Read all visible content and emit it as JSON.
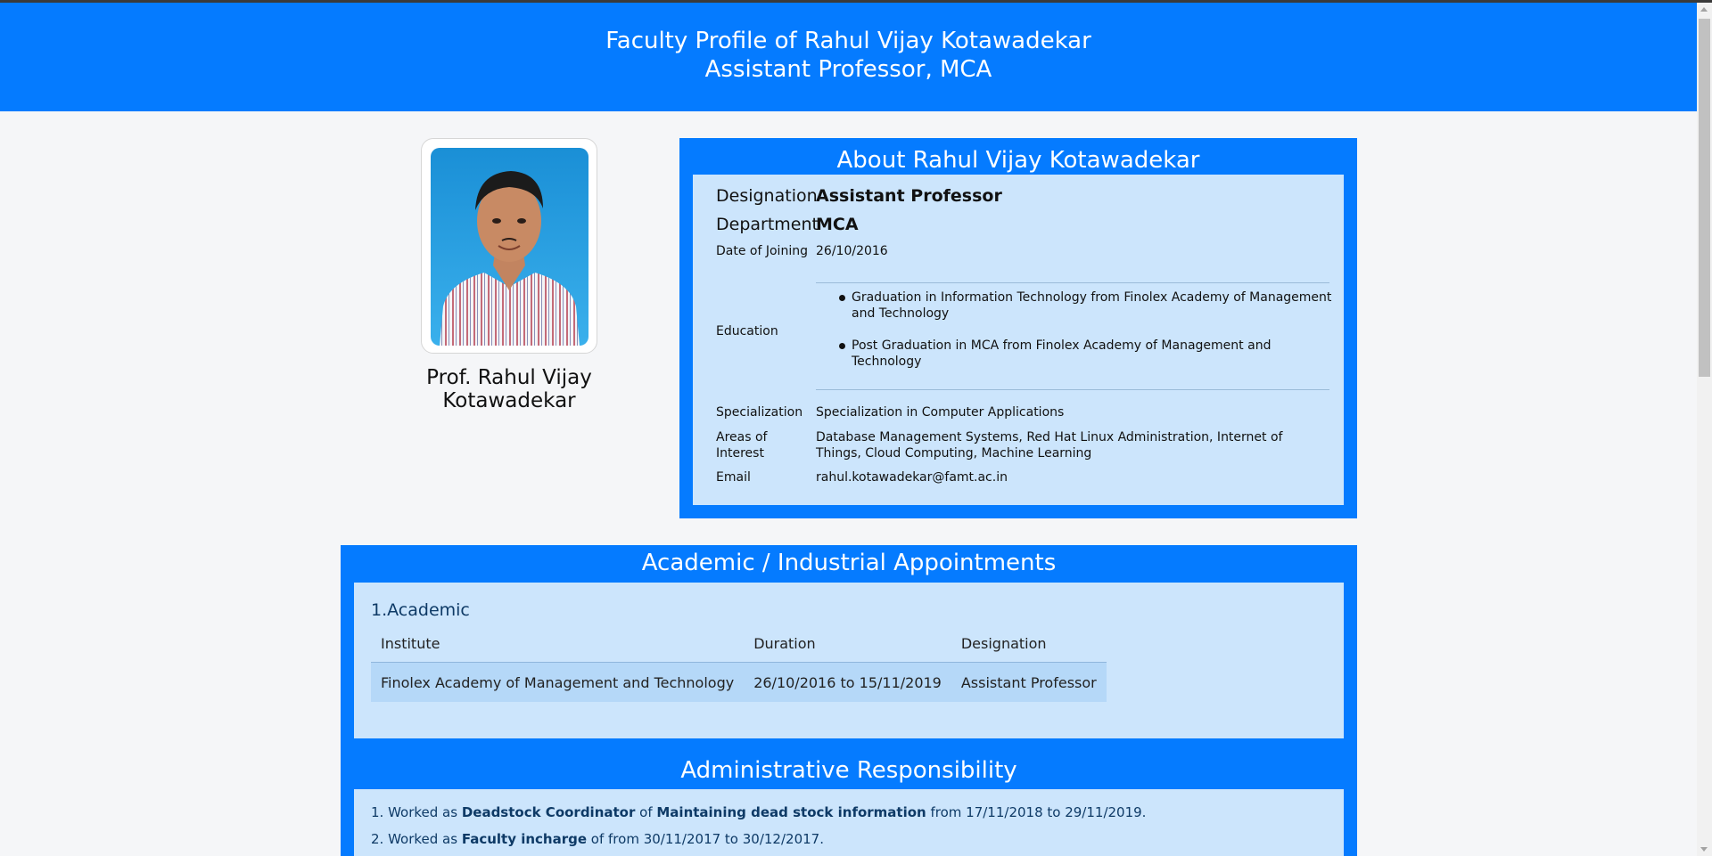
{
  "header": {
    "title_line1": "Faculty Profile of Rahul Vijay Kotawadekar",
    "title_line2": "Assistant Professor, MCA"
  },
  "profile": {
    "name": "Prof. Rahul Vijay Kotawadekar"
  },
  "about": {
    "heading": "About Rahul Vijay Kotawadekar",
    "designation_label": "Designation",
    "designation_value": "Assistant Professor",
    "department_label": "Department",
    "department_value": "MCA",
    "joining_label": "Date of Joining",
    "joining_value": "26/10/2016",
    "education_label": "Education",
    "education": [
      "Graduation in Information Technology from Finolex Academy of Management and Technology",
      "Post Graduation in MCA from Finolex Academy of Management and Technology"
    ],
    "specialization_label": "Specialization",
    "specialization_value": "Specialization in Computer Applications",
    "interest_label": "Areas of Interest",
    "interest_value": "Database Management Systems, Red Hat Linux Administration, Internet of Things, Cloud Computing, Machine Learning",
    "email_label": "Email",
    "email_value": "rahul.kotawadekar@famt.ac.in"
  },
  "appointments": {
    "heading": "Academic / Industrial Appointments",
    "academic_title": "1.Academic",
    "columns": [
      "Institute",
      "Duration",
      "Designation"
    ],
    "rows": [
      [
        "Finolex Academy of Management and Technology",
        "26/10/2016 to 15/11/2019",
        "Assistant Professor"
      ]
    ]
  },
  "administrative": {
    "heading": "Administrative Responsibility",
    "items": [
      {
        "prefix": "1. Worked as ",
        "role": "Deadstock Coordinator",
        "mid": " of ",
        "task": "Maintaining dead stock information",
        "suffix": " from 17/11/2018 to 29/11/2019."
      },
      {
        "prefix": "2. Worked as ",
        "role": "Faculty incharge",
        "mid": " of from 30/11/2017 to 30/12/2017.",
        "task": "",
        "suffix": ""
      }
    ]
  }
}
